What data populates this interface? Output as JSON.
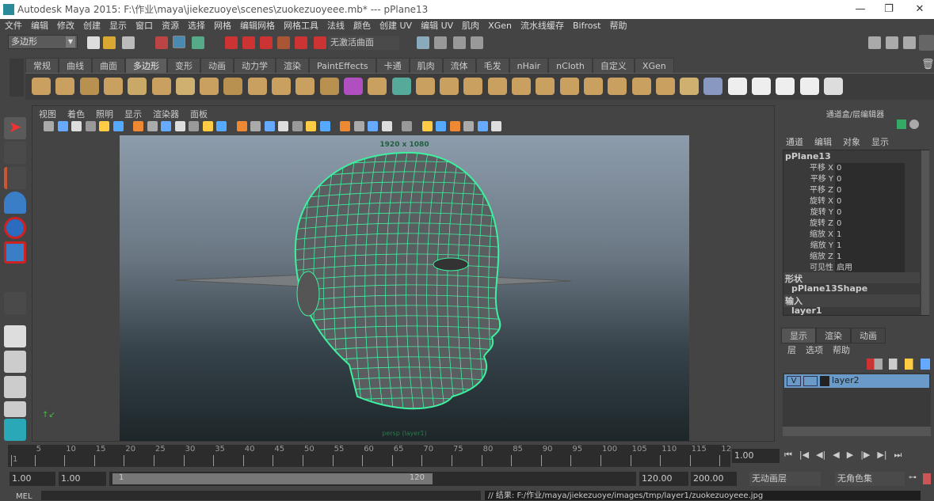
{
  "window": {
    "title": "Autodesk Maya 2015: F:\\作业\\maya\\jiekezuoye\\scenes\\zuokezuoyeee.mb*   ---   pPlane13",
    "minimize": "—",
    "maximize": "❐",
    "close": "✕"
  },
  "menu": [
    "文件",
    "编辑",
    "修改",
    "创建",
    "显示",
    "窗口",
    "资源",
    "选择",
    "网格",
    "编辑网格",
    "网格工具",
    "法线",
    "颜色",
    "创建 UV",
    "编辑 UV",
    "肌肉",
    "XGen",
    "流水线缓存",
    "Bifrost",
    "帮助"
  ],
  "status_line": {
    "menu_set": "多边形",
    "live_surface": "无激活曲面"
  },
  "shelf_tabs": [
    "常规",
    "曲线",
    "曲面",
    "多边形",
    "变形",
    "动画",
    "动力学",
    "渲染",
    "PaintEffects",
    "卡通",
    "肌肉",
    "流体",
    "毛发",
    "nHair",
    "nCloth",
    "自定义",
    "XGen"
  ],
  "active_shelf_tab": "多边形",
  "viewport": {
    "menu": [
      "视图",
      "着色",
      "照明",
      "显示",
      "渲染器",
      "面板"
    ],
    "resolution": "1920 x 1080",
    "camera_label": "persp (layer1)",
    "wire_color": "#3ef0a0"
  },
  "channel_box": {
    "title": "通道盒/层编辑器",
    "menu": [
      "通道",
      "编辑",
      "对象",
      "显示"
    ],
    "object": "pPlane13",
    "attributes": [
      {
        "label": "平移 X",
        "value": "0"
      },
      {
        "label": "平移 Y",
        "value": "0"
      },
      {
        "label": "平移 Z",
        "value": "0"
      },
      {
        "label": "旋转 X",
        "value": "0"
      },
      {
        "label": "旋转 Y",
        "value": "0"
      },
      {
        "label": "旋转 Z",
        "value": "0"
      },
      {
        "label": "缩放 X",
        "value": "1"
      },
      {
        "label": "缩放 Y",
        "value": "1"
      },
      {
        "label": "缩放 Z",
        "value": "1"
      },
      {
        "label": "可见性",
        "value": "启用"
      }
    ],
    "shapes_header": "形状",
    "shape": "pPlane13Shape",
    "inputs_header": "输入",
    "input": "layer1"
  },
  "layer_editor": {
    "tabs": [
      "显示",
      "渲染",
      "动画"
    ],
    "menu": [
      "层",
      "选项",
      "帮助"
    ],
    "layer": {
      "visible": "V",
      "name": "layer2"
    }
  },
  "timeline": {
    "ticks": [
      "1",
      "5",
      "10",
      "15",
      "20",
      "25",
      "30",
      "35",
      "40",
      "45",
      "50",
      "55",
      "60",
      "65",
      "70",
      "75",
      "80",
      "85",
      "90",
      "95",
      "100",
      "105",
      "110",
      "115",
      "12"
    ],
    "current_time": "1.00"
  },
  "range": {
    "start": "1.00",
    "playback_start": "1.00",
    "slider_start": "1",
    "slider_end": "120",
    "playback_end": "120.00",
    "end": "200.00",
    "anim_layer": "无动画层",
    "char_set": "无角色集"
  },
  "command_line": {
    "label": "MEL",
    "result": "// 结果: F:/作业/maya/jiekezuoye/images/tmp/layer1/zuokezuoyeee.jpg"
  }
}
